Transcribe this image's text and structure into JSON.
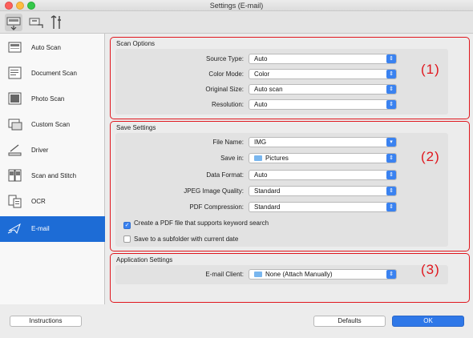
{
  "window": {
    "title": "Settings (E-mail)"
  },
  "toolbar": {
    "icons": [
      "scan-tab-icon",
      "scan-from-panel-icon",
      "general-settings-icon"
    ]
  },
  "sidebar": {
    "items": [
      {
        "label": "Auto Scan"
      },
      {
        "label": "Document Scan"
      },
      {
        "label": "Photo Scan"
      },
      {
        "label": "Custom Scan"
      },
      {
        "label": "Driver"
      },
      {
        "label": "Scan and Stitch"
      },
      {
        "label": "OCR"
      },
      {
        "label": "E-mail"
      }
    ],
    "active": "E-mail"
  },
  "scan_options": {
    "title": "Scan Options",
    "number": "(1)",
    "source_type": {
      "label": "Source Type:",
      "value": "Auto"
    },
    "color_mode": {
      "label": "Color Mode:",
      "value": "Color"
    },
    "original_size": {
      "label": "Original Size:",
      "value": "Auto scan"
    },
    "resolution": {
      "label": "Resolution:",
      "value": "Auto"
    }
  },
  "save_settings": {
    "title": "Save Settings",
    "number": "(2)",
    "file_name": {
      "label": "File Name:",
      "value": "IMG"
    },
    "save_in": {
      "label": "Save in:",
      "value": "Pictures"
    },
    "data_format": {
      "label": "Data Format:",
      "value": "Auto"
    },
    "jpeg_quality": {
      "label": "JPEG Image Quality:",
      "value": "Standard"
    },
    "pdf_compression": {
      "label": "PDF Compression:",
      "value": "Standard"
    },
    "keyword_pdf": {
      "label": "Create a PDF file that supports keyword search",
      "checked": true
    },
    "subfolder": {
      "label": "Save to a subfolder with current date",
      "checked": false
    }
  },
  "app_settings": {
    "title": "Application Settings",
    "number": "(3)",
    "email_client": {
      "label": "E-mail Client:",
      "value": "None (Attach Manually)"
    }
  },
  "buttons": {
    "instructions": "Instructions",
    "defaults": "Defaults",
    "ok": "OK"
  },
  "colors": {
    "accent": "#1d6cd6",
    "callout": "#e0161d"
  }
}
